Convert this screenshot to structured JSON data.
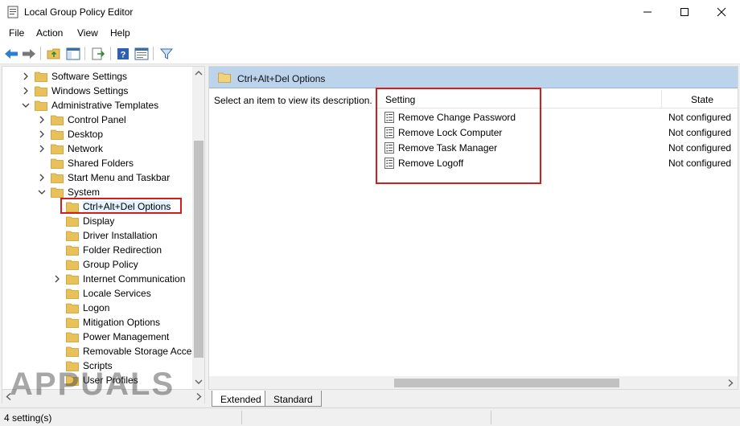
{
  "window": {
    "title": "Local Group Policy Editor",
    "controls": [
      "minimize",
      "maximize",
      "close"
    ]
  },
  "menu": {
    "items": [
      "File",
      "Action",
      "View",
      "Help"
    ]
  },
  "toolbar": {
    "icons": [
      "back-icon",
      "forward-icon",
      "up-folder-icon",
      "show-hide-tree-icon",
      "export-list-icon",
      "help-icon",
      "properties-view-icon",
      "filter-icon"
    ]
  },
  "tree": {
    "items": [
      {
        "label": "Software Settings",
        "depth": 1,
        "expander": "collapsed"
      },
      {
        "label": "Windows Settings",
        "depth": 1,
        "expander": "collapsed"
      },
      {
        "label": "Administrative Templates",
        "depth": 1,
        "expander": "expanded"
      },
      {
        "label": "Control Panel",
        "depth": 2,
        "expander": "collapsed"
      },
      {
        "label": "Desktop",
        "depth": 2,
        "expander": "collapsed"
      },
      {
        "label": "Network",
        "depth": 2,
        "expander": "collapsed"
      },
      {
        "label": "Shared Folders",
        "depth": 2,
        "expander": "none"
      },
      {
        "label": "Start Menu and Taskbar",
        "depth": 2,
        "expander": "collapsed"
      },
      {
        "label": "System",
        "depth": 2,
        "expander": "expanded"
      },
      {
        "label": "Ctrl+Alt+Del Options",
        "depth": 3,
        "expander": "none",
        "selected": true
      },
      {
        "label": "Display",
        "depth": 3,
        "expander": "none"
      },
      {
        "label": "Driver Installation",
        "depth": 3,
        "expander": "none"
      },
      {
        "label": "Folder Redirection",
        "depth": 3,
        "expander": "none"
      },
      {
        "label": "Group Policy",
        "depth": 3,
        "expander": "none"
      },
      {
        "label": "Internet Communication",
        "depth": 3,
        "expander": "collapsed"
      },
      {
        "label": "Locale Services",
        "depth": 3,
        "expander": "none"
      },
      {
        "label": "Logon",
        "depth": 3,
        "expander": "none"
      },
      {
        "label": "Mitigation Options",
        "depth": 3,
        "expander": "none"
      },
      {
        "label": "Power Management",
        "depth": 3,
        "expander": "none"
      },
      {
        "label": "Removable Storage Access",
        "depth": 3,
        "expander": "none"
      },
      {
        "label": "Scripts",
        "depth": 3,
        "expander": "none"
      },
      {
        "label": "User Profiles",
        "depth": 3,
        "expander": "none"
      }
    ]
  },
  "details": {
    "path_title": "Ctrl+Alt+Del Options",
    "description_prompt": "Select an item to view its description.",
    "columns": {
      "setting": "Setting",
      "state": "State"
    },
    "rows": [
      {
        "name": "Remove Change Password",
        "state": "Not configured"
      },
      {
        "name": "Remove Lock Computer",
        "state": "Not configured"
      },
      {
        "name": "Remove Task Manager",
        "state": "Not configured"
      },
      {
        "name": "Remove Logoff",
        "state": "Not configured"
      }
    ]
  },
  "tabs": [
    "Extended",
    "Standard"
  ],
  "status": {
    "text": "4 setting(s)"
  },
  "watermark": {
    "text": "APPUALS"
  },
  "colors": {
    "highlight_box": "#d21e1e",
    "path_bar": "#bcd3ec",
    "folder": "#e8c15a"
  }
}
